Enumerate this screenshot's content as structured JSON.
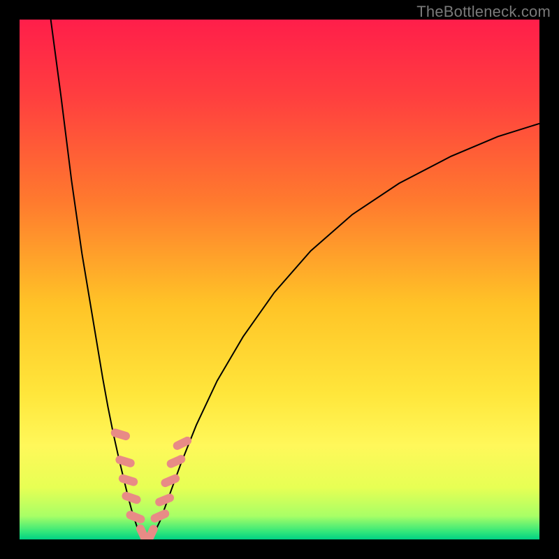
{
  "watermark": "TheBottleneck.com",
  "colors": {
    "frame": "#000000",
    "gradient_stops": [
      {
        "offset": 0.0,
        "color": "#ff1e4a"
      },
      {
        "offset": 0.15,
        "color": "#ff3f3f"
      },
      {
        "offset": 0.35,
        "color": "#ff7a2e"
      },
      {
        "offset": 0.55,
        "color": "#ffc427"
      },
      {
        "offset": 0.72,
        "color": "#ffe63b"
      },
      {
        "offset": 0.82,
        "color": "#fff85a"
      },
      {
        "offset": 0.9,
        "color": "#e7ff54"
      },
      {
        "offset": 0.955,
        "color": "#a8ff66"
      },
      {
        "offset": 0.985,
        "color": "#33e77a"
      },
      {
        "offset": 1.0,
        "color": "#00d184"
      }
    ],
    "curve_stroke": "#000000",
    "marker_fill": "#e88b86",
    "marker_stroke": "#e88b86"
  },
  "chart_data": {
    "type": "line",
    "title": "",
    "xlabel": "",
    "ylabel": "",
    "xlim": [
      0,
      100
    ],
    "ylim": [
      0,
      100
    ],
    "grid": false,
    "series": [
      {
        "name": "left-branch",
        "x": [
          6.0,
          8.0,
          10.0,
          12.0,
          14.0,
          16.0,
          17.0,
          18.0,
          19.0,
          20.0,
          20.8,
          21.6,
          22.4,
          23.0
        ],
        "y": [
          100.0,
          85.0,
          69.0,
          55.0,
          43.0,
          31.0,
          25.5,
          20.5,
          16.0,
          11.8,
          8.5,
          5.5,
          3.0,
          1.2
        ]
      },
      {
        "name": "valley-bottom",
        "x": [
          23.0,
          24.0,
          25.0,
          25.8
        ],
        "y": [
          1.2,
          0.4,
          0.4,
          1.0
        ]
      },
      {
        "name": "right-branch",
        "x": [
          25.8,
          27.0,
          29.0,
          31.0,
          34.0,
          38.0,
          43.0,
          49.0,
          56.0,
          64.0,
          73.0,
          83.0,
          92.0,
          100.0
        ],
        "y": [
          1.0,
          3.5,
          9.0,
          14.5,
          22.0,
          30.5,
          39.0,
          47.5,
          55.5,
          62.5,
          68.5,
          73.7,
          77.5,
          80.0
        ]
      }
    ],
    "markers": [
      {
        "x": 19.4,
        "y": 20.2,
        "rot": -73
      },
      {
        "x": 20.3,
        "y": 15.0,
        "rot": -73
      },
      {
        "x": 20.9,
        "y": 11.4,
        "rot": -73
      },
      {
        "x": 21.5,
        "y": 8.0,
        "rot": -71
      },
      {
        "x": 22.3,
        "y": 4.3,
        "rot": -68
      },
      {
        "x": 23.7,
        "y": 1.1,
        "rot": -25
      },
      {
        "x": 25.3,
        "y": 1.0,
        "rot": 25
      },
      {
        "x": 27.0,
        "y": 4.5,
        "rot": 66
      },
      {
        "x": 27.9,
        "y": 7.6,
        "rot": 68
      },
      {
        "x": 29.0,
        "y": 11.3,
        "rot": 67
      },
      {
        "x": 30.1,
        "y": 15.0,
        "rot": 66
      },
      {
        "x": 31.3,
        "y": 18.5,
        "rot": 64
      }
    ]
  }
}
